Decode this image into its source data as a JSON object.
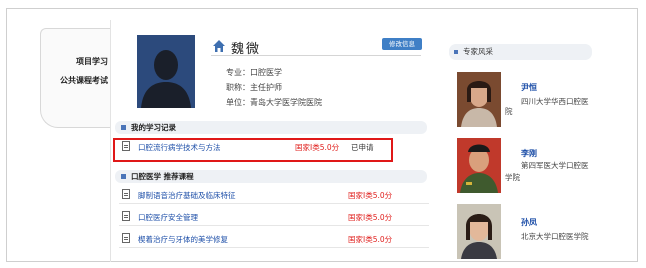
{
  "tabs": {
    "project_study": "项目学习",
    "public_exam": "公共课程考试"
  },
  "profile": {
    "name": "魏微",
    "edit_label": "修改信息",
    "major": "专业：口腔医学",
    "title": "职称：主任护师",
    "unit": "单位：青岛大学医学院医院"
  },
  "my_records": {
    "heading": "我的学习记录",
    "rows": [
      {
        "title": "口腔流行病学技术与方法",
        "credit": "国家I类5.0分",
        "status": "已申请"
      }
    ]
  },
  "recommended": {
    "heading": "口腔医学 推荐课程",
    "rows": [
      {
        "title": "脚制语音治疗基础及临床特征",
        "credit": "国家I类5.0分"
      },
      {
        "title": "口腔医疗安全管理",
        "credit": "国家I类5.0分"
      },
      {
        "title": "楔着治疗与牙体的美学修复",
        "credit": "国家I类5.0分"
      }
    ]
  },
  "experts": {
    "heading": "专家风采",
    "items": [
      {
        "name": "尹恒",
        "affiliation_line1": "四川大学华西口腔医",
        "affiliation_line2": "院"
      },
      {
        "name": "李刚",
        "affiliation_line1": "第四军医大学口腔医",
        "affiliation_line2": "学院"
      },
      {
        "name": "孙凤",
        "affiliation_line1": "北京大学口腔医学院",
        "affiliation_line2": ""
      }
    ]
  },
  "colors": {
    "highlight_border": "#e01818",
    "link_blue": "#1e4fa8",
    "credit_red": "#e0201e",
    "edit_button": "#3f7fc6",
    "avatar_bg": "#2c4a7c"
  }
}
